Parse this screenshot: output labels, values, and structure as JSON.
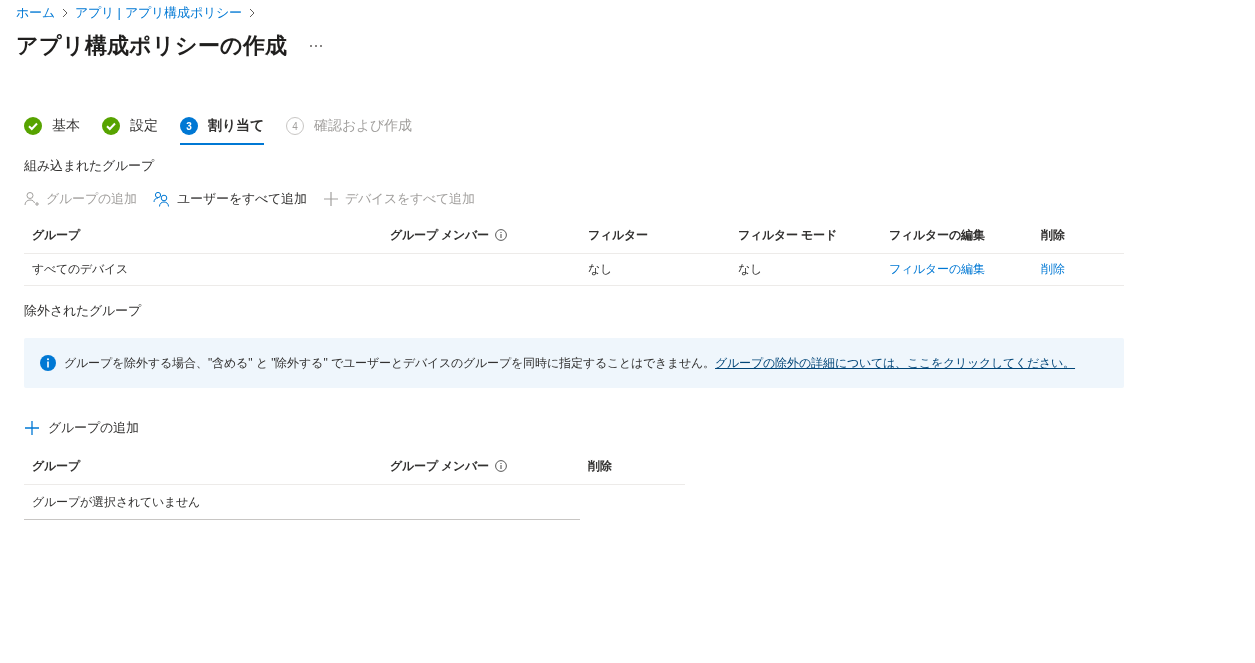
{
  "breadcrumb": [
    {
      "label": "ホーム"
    },
    {
      "label": "アプリ | アプリ構成ポリシー"
    }
  ],
  "title": "アプリ構成ポリシーの作成",
  "steps": [
    {
      "label": "基本",
      "kind": "done",
      "selected": false
    },
    {
      "label": "設定",
      "kind": "done",
      "selected": false
    },
    {
      "label": "割り当て",
      "number": "3",
      "kind": "current",
      "selected": true
    },
    {
      "label": "確認および作成",
      "number": "4",
      "kind": "pending",
      "selected": false
    }
  ],
  "included": {
    "heading": "組み込まれたグループ",
    "toolbar": [
      {
        "label": "グループの追加",
        "kind": "person-add",
        "disabled": true
      },
      {
        "label": "ユーザーをすべて追加",
        "kind": "people",
        "disabled": false
      },
      {
        "label": "デバイスをすべて追加",
        "kind": "plus",
        "disabled": true
      }
    ],
    "columns": [
      {
        "label": "グループ",
        "info": false
      },
      {
        "label": "グループ メンバー",
        "info": true
      },
      {
        "label": "フィルター",
        "info": false
      },
      {
        "label": "フィルター モード",
        "info": false
      },
      {
        "label": "フィルターの編集",
        "info": false
      },
      {
        "label": "削除",
        "info": false
      }
    ],
    "rows": [
      {
        "cells": [
          {
            "text": "すべてのデバイス",
            "kind": "text"
          },
          {
            "kind": "blank"
          },
          {
            "text": "なし",
            "kind": "text"
          },
          {
            "text": "なし",
            "kind": "text"
          },
          {
            "text": "フィルターの編集",
            "kind": "link"
          },
          {
            "text": "削除",
            "kind": "link"
          }
        ]
      }
    ]
  },
  "excluded": {
    "heading": "除外されたグループ",
    "banner": {
      "text": "グループを除外する場合、\"含める\" と \"除外する\" でユーザーとデバイスのグループを同時に指定することはできません。",
      "link": "グループの除外の詳細については、ここをクリックしてください。"
    },
    "add_button": {
      "label": "グループの追加"
    },
    "columns": [
      {
        "label": "グループ",
        "info": false
      },
      {
        "label": "グループ メンバー",
        "info": true
      },
      {
        "label": "削除",
        "info": false
      }
    ],
    "empty_message": "グループが選択されていません"
  }
}
